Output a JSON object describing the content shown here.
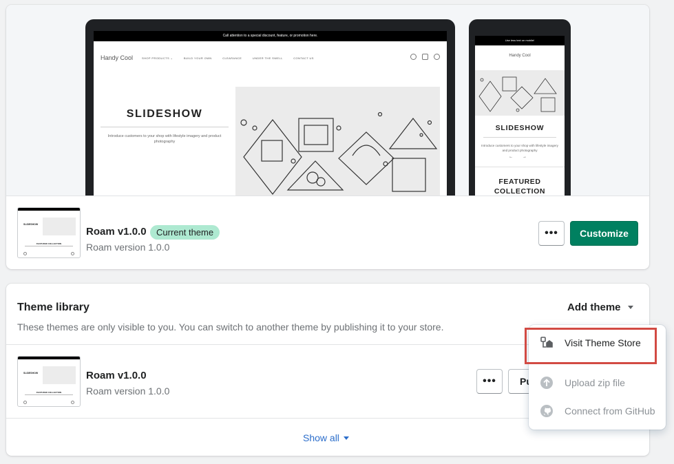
{
  "current_theme": {
    "preview": {
      "desktop": {
        "announcement": "Call attention to a special discount, feature, or promotion here.",
        "store_name": "Handy Cool",
        "nav_links": [
          "SHOP PRODUCTS ⌄",
          "BUILD YOUR OWN",
          "CLEARANCE",
          "UNDER THE SWELL",
          "CONTACT US"
        ],
        "slideshow_title": "SLIDESHOW",
        "slideshow_desc": "Introduce customers to your shop with lifestyle imagery and product photography"
      },
      "mobile": {
        "announcement": "Use less text on mobile!",
        "store_name": "Handy Cool",
        "slideshow_title": "SLIDESHOW",
        "slideshow_desc": "Introduce customers to your shop with lifestyle imagery and product photography",
        "arrows": "← →",
        "featured": "FEATURED COLLECTION"
      }
    },
    "thumb": {
      "title": "SLIDESHOW",
      "featured": "FEATURED COLLECTION"
    },
    "name": "Roam v1.0.0",
    "badge": "Current theme",
    "version": "Roam version 1.0.0",
    "more_label": "•••",
    "customize_label": "Customize"
  },
  "library": {
    "title": "Theme library",
    "description": "These themes are only visible to you. You can switch to another theme by publishing it to your store.",
    "add_theme_label": "Add theme",
    "item": {
      "name": "Roam v1.0.0",
      "version": "Roam version 1.0.0",
      "more_label": "•••",
      "publish_label": "Publish",
      "thumb_title": "SLIDESHOW",
      "thumb_featured": "FEATURED COLLECTION"
    },
    "show_all_label": "Show all"
  },
  "add_theme_menu": {
    "items": [
      {
        "label": "Visit Theme Store",
        "icon": "theme-store-icon",
        "enabled": true
      },
      {
        "label": "Upload zip file",
        "icon": "upload-icon",
        "enabled": false
      },
      {
        "label": "Connect from GitHub",
        "icon": "github-icon",
        "enabled": false
      }
    ]
  },
  "colors": {
    "primary": "#008060",
    "badge_bg": "#aee9d1",
    "link": "#2c6ecb",
    "highlight": "#d24a43"
  }
}
